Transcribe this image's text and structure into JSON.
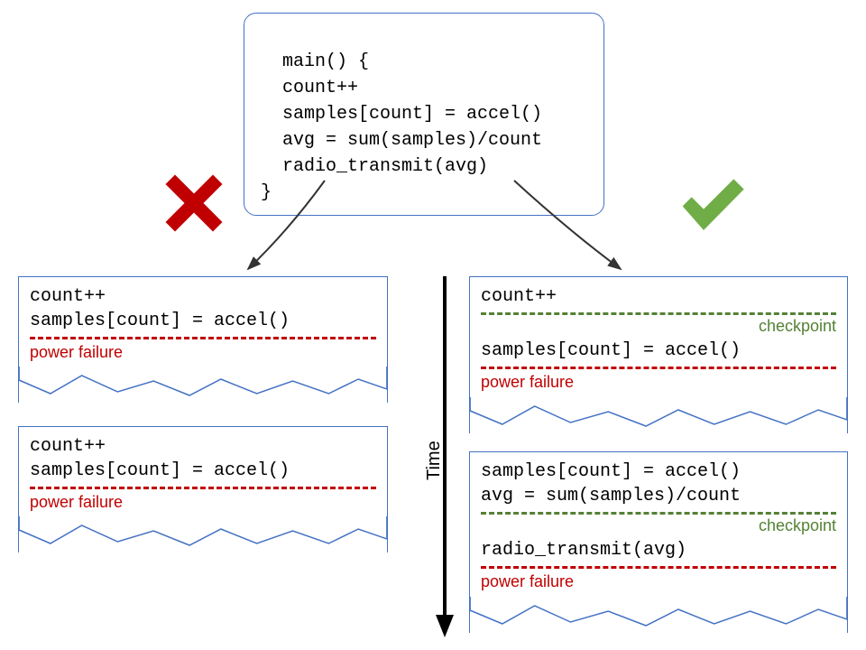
{
  "main_code": "main() {\n  count++\n  samples[count] = accel()\n  avg = sum(samples)/count\n  radio_transmit(avg)\n}",
  "failure_label": "power failure",
  "checkpoint_label": "checkpoint",
  "time_label": "Time",
  "left": {
    "box1_code": "count++\nsamples[count] = accel()",
    "box2_code": "count++\nsamples[count] = accel()"
  },
  "right": {
    "box1_line1": "count++",
    "box1_line2": "samples[count] = accel()",
    "box2_lines_a": "samples[count] = accel()\navg = sum(samples)/count",
    "box2_lines_b": "radio_transmit(avg)"
  },
  "colors": {
    "box_border": "#4472C4",
    "red": "#C00000",
    "green": "#548235",
    "check": "#70AD47",
    "cross": "#C00000"
  }
}
